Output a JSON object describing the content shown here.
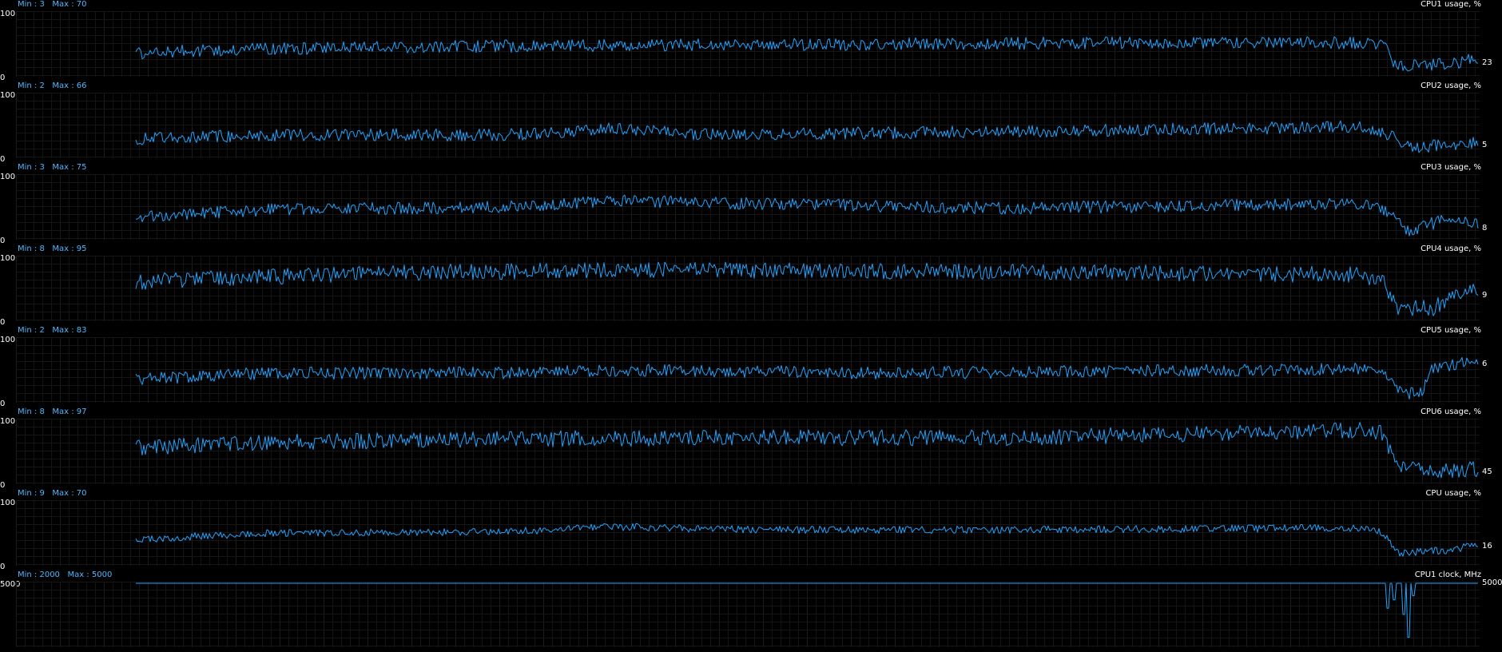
{
  "chart_data": [
    {
      "type": "line",
      "title": "CPU1 usage, %",
      "min_label": "Min : 3",
      "max_label": "Max : 70",
      "ytick_top": "100",
      "ytick_bottom": "0",
      "current": "23",
      "ylim": [
        0,
        100
      ],
      "grid": true,
      "line_color": "#1fa4ff",
      "profile": [
        [
          0,
          35
        ],
        [
          0.05,
          40
        ],
        [
          0.2,
          45
        ],
        [
          0.4,
          48
        ],
        [
          0.6,
          50
        ],
        [
          0.8,
          52
        ],
        [
          0.98,
          52
        ],
        [
          1.0,
          50
        ],
        [
          1.01,
          15
        ],
        [
          1.05,
          18
        ],
        [
          1.09,
          30
        ],
        [
          1.12,
          22
        ],
        [
          1.16,
          20
        ]
      ],
      "noise": 10,
      "seed": 11
    },
    {
      "type": "line",
      "title": "CPU2 usage, %",
      "min_label": "Min : 2",
      "max_label": "Max : 66",
      "ytick_top": "100",
      "ytick_bottom": "0",
      "current": "5",
      "ylim": [
        0,
        100
      ],
      "grid": true,
      "line_color": "#1fa4ff",
      "profile": [
        [
          0,
          28
        ],
        [
          0.1,
          35
        ],
        [
          0.3,
          35
        ],
        [
          0.38,
          45
        ],
        [
          0.45,
          35
        ],
        [
          0.7,
          40
        ],
        [
          0.98,
          48
        ],
        [
          1.0,
          40
        ],
        [
          1.02,
          15
        ],
        [
          1.06,
          20
        ],
        [
          1.1,
          30
        ],
        [
          1.13,
          22
        ],
        [
          1.16,
          8
        ]
      ],
      "noise": 10,
      "seed": 22
    },
    {
      "type": "line",
      "title": "CPU3 usage, %",
      "min_label": "Min : 3",
      "max_label": "Max : 75",
      "ytick_top": "100",
      "ytick_bottom": "0",
      "current": "8",
      "ylim": [
        0,
        100
      ],
      "grid": true,
      "line_color": "#1fa4ff",
      "profile": [
        [
          0,
          35
        ],
        [
          0.1,
          45
        ],
        [
          0.3,
          50
        ],
        [
          0.38,
          60
        ],
        [
          0.5,
          55
        ],
        [
          0.7,
          48
        ],
        [
          0.98,
          55
        ],
        [
          1.0,
          45
        ],
        [
          1.02,
          12
        ],
        [
          1.05,
          30
        ],
        [
          1.08,
          20
        ],
        [
          1.12,
          18
        ],
        [
          1.16,
          15
        ]
      ],
      "noise": 10,
      "seed": 33
    },
    {
      "type": "line",
      "title": "CPU4 usage, %",
      "min_label": "Min : 8",
      "max_label": "Max : 95",
      "ytick_top": "100",
      "ytick_bottom": "0",
      "current": "9",
      "ylim": [
        0,
        100
      ],
      "grid": true,
      "line_color": "#1fa4ff",
      "profile": [
        [
          0,
          60
        ],
        [
          0.05,
          65
        ],
        [
          0.2,
          75
        ],
        [
          0.4,
          80
        ],
        [
          0.6,
          78
        ],
        [
          0.8,
          75
        ],
        [
          0.98,
          72
        ],
        [
          1.0,
          60
        ],
        [
          1.01,
          20
        ],
        [
          1.04,
          18
        ],
        [
          1.06,
          45
        ],
        [
          1.1,
          48
        ],
        [
          1.14,
          40
        ],
        [
          1.16,
          10
        ]
      ],
      "noise": 13,
      "seed": 44
    },
    {
      "type": "line",
      "title": "CPU5 usage, %",
      "min_label": "Min : 2",
      "max_label": "Max : 83",
      "ytick_top": "100",
      "ytick_bottom": "0",
      "current": "6",
      "ylim": [
        0,
        100
      ],
      "grid": true,
      "line_color": "#1fa4ff",
      "profile": [
        [
          0,
          35
        ],
        [
          0.1,
          45
        ],
        [
          0.3,
          45
        ],
        [
          0.4,
          50
        ],
        [
          0.6,
          45
        ],
        [
          0.8,
          48
        ],
        [
          0.98,
          52
        ],
        [
          1.0,
          40
        ],
        [
          1.015,
          10
        ],
        [
          1.03,
          15
        ],
        [
          1.04,
          55
        ],
        [
          1.1,
          70
        ],
        [
          1.14,
          55
        ],
        [
          1.16,
          8
        ]
      ],
      "noise": 10,
      "seed": 55
    },
    {
      "type": "line",
      "title": "CPU6 usage, %",
      "min_label": "Min : 8",
      "max_label": "Max : 97",
      "ytick_top": "100",
      "ytick_bottom": "0",
      "current": "45",
      "ylim": [
        0,
        100
      ],
      "grid": true,
      "line_color": "#1fa4ff",
      "profile": [
        [
          0,
          55
        ],
        [
          0.1,
          65
        ],
        [
          0.3,
          70
        ],
        [
          0.5,
          72
        ],
        [
          0.7,
          72
        ],
        [
          0.9,
          80
        ],
        [
          0.98,
          85
        ],
        [
          1.0,
          80
        ],
        [
          1.01,
          25
        ],
        [
          1.05,
          20
        ],
        [
          1.1,
          25
        ],
        [
          1.14,
          30
        ],
        [
          1.16,
          40
        ]
      ],
      "noise": 13,
      "seed": 66
    },
    {
      "type": "line",
      "title": "CPU usage, %",
      "min_label": "Min : 9",
      "max_label": "Max : 70",
      "ytick_top": "100",
      "ytick_bottom": "0",
      "current": "16",
      "ylim": [
        0,
        100
      ],
      "grid": true,
      "line_color": "#1fa4ff",
      "profile": [
        [
          0,
          40
        ],
        [
          0.1,
          50
        ],
        [
          0.3,
          52
        ],
        [
          0.38,
          60
        ],
        [
          0.5,
          55
        ],
        [
          0.7,
          55
        ],
        [
          0.98,
          58
        ],
        [
          1.0,
          50
        ],
        [
          1.01,
          18
        ],
        [
          1.05,
          22
        ],
        [
          1.09,
          35
        ],
        [
          1.13,
          25
        ],
        [
          1.16,
          15
        ]
      ],
      "noise": 6,
      "seed": 77
    },
    {
      "type": "line",
      "title": "CPU1 clock, MHz",
      "min_label": "Min : 2000",
      "max_label": "Max : 5000",
      "ytick_top": "5000",
      "ytick_bottom": "",
      "current": "5000",
      "ylim": [
        2000,
        5000
      ],
      "grid": true,
      "line_color": "#1fa4ff",
      "profile": [
        [
          0,
          5000
        ],
        [
          1.16,
          5000
        ]
      ],
      "noise": 0,
      "seed": 88,
      "dips": [
        [
          1.003,
          3800
        ],
        [
          1.008,
          4200
        ],
        [
          1.016,
          3500
        ],
        [
          1.02,
          2400
        ],
        [
          1.024,
          4400
        ],
        [
          1.155,
          3900
        ],
        [
          1.16,
          4300
        ]
      ]
    }
  ]
}
